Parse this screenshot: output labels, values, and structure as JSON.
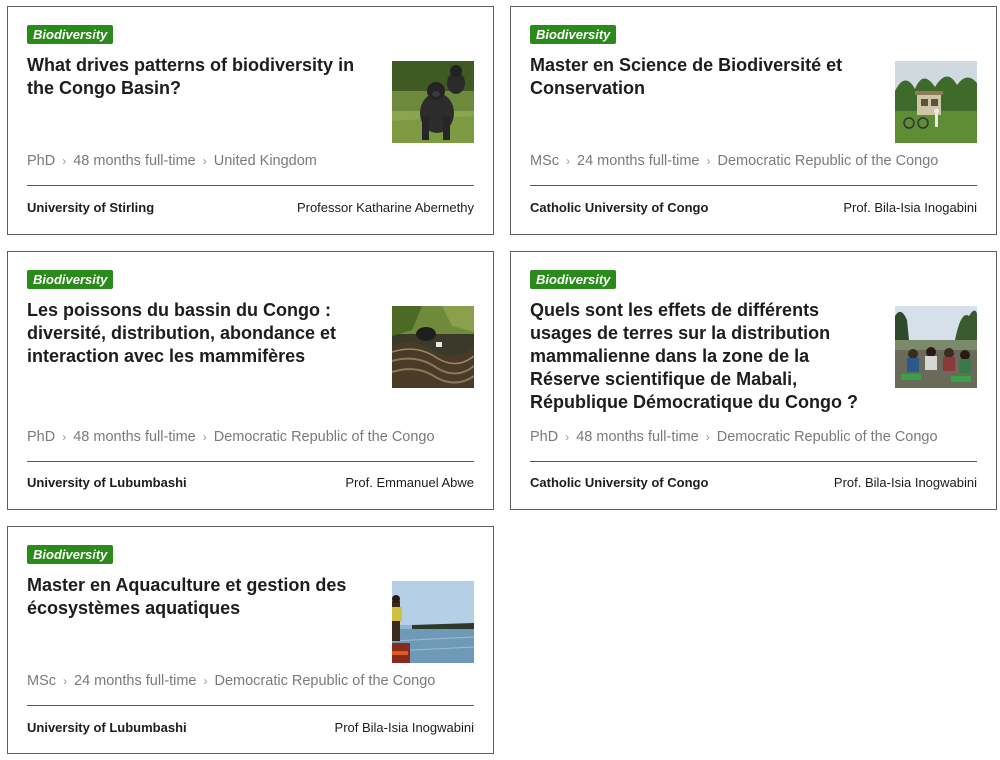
{
  "cards": [
    {
      "tag": "Biodiversity",
      "title": "What drives patterns of biodiversity in the Congo Basin?",
      "level": "PhD",
      "duration": "48 months full-time",
      "country": "United Kingdom",
      "university": "University of Stirling",
      "supervisor": "Professor Katharine Abernethy",
      "image_icon": "gorilla-photo"
    },
    {
      "tag": "Biodiversity",
      "title": "Master en Science de Biodiversité et Conservation",
      "level": "MSc",
      "duration": "24 months full-time",
      "country": "Democratic Republic of the Congo",
      "university": "Catholic University of Congo",
      "supervisor": "Prof. Bila-Isia Inogabini",
      "image_icon": "field-station-photo"
    },
    {
      "tag": "Biodiversity",
      "title": "Les poissons du bassin du Congo : diversité, distribution, abondance et interaction avec les mammifères",
      "level": "PhD",
      "duration": "48 months full-time",
      "country": "Democratic Republic of the Congo",
      "university": "University of Lubumbashi",
      "supervisor": "Prof. Emmanuel Abwe",
      "image_icon": "river-rocks-photo"
    },
    {
      "tag": "Biodiversity",
      "title": "Quels sont les effets de différents usages de terres sur la distribution mammalienne dans la zone de la Réserve scientifique de Mabali, République Démocratique du Congo ?",
      "level": "PhD",
      "duration": "48 months full-time",
      "country": "Democratic Republic of the Congo",
      "university": "Catholic University of Congo",
      "supervisor": "Prof. Bila-Isia Inogwabini",
      "image_icon": "group-meeting-photo"
    },
    {
      "tag": "Biodiversity",
      "title": "Master en Aquaculture et gestion des écosystèmes aquatiques",
      "level": "MSc",
      "duration": "24 months full-time",
      "country": "Democratic Republic of the Congo",
      "university": "University of Lubumbashi",
      "supervisor": "Prof Bila-Isia Inogwabini",
      "image_icon": "river-canoe-photo"
    }
  ],
  "colors": {
    "badge_bg": "#2a8a1a",
    "title_text": "#1d1d1d",
    "meta_text": "#7a7a7a",
    "card_border": "#5e5e5e"
  }
}
